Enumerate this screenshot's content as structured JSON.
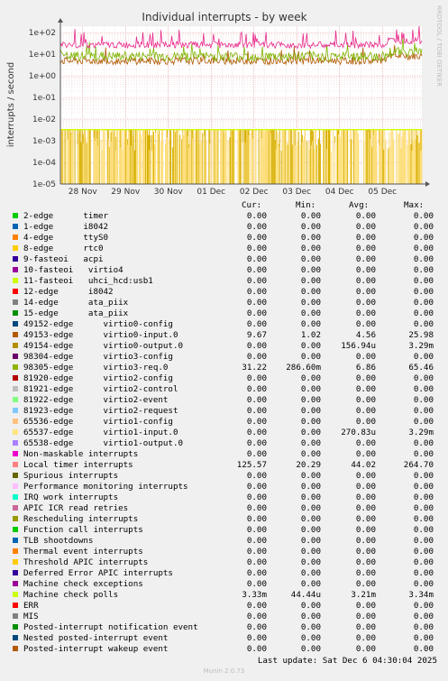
{
  "chart_data": {
    "type": "line",
    "title": "Individual interrupts - by week",
    "ylabel": "interrupts / second",
    "yscale": "log",
    "ylim": [
      1e-05,
      200
    ],
    "yticks": [
      "1e+02",
      "1e+01",
      "1e+00",
      "1e-01",
      "1e-02",
      "1e-03",
      "1e-04",
      "1e-05"
    ],
    "xlim": [
      "27 Nov",
      "6 Dec 04:30"
    ],
    "xticks": [
      "28 Nov",
      "29 Nov",
      "30 Nov",
      "01 Dec",
      "02 Dec",
      "03 Dec",
      "04 Dec",
      "05 Dec"
    ],
    "grid": true,
    "series": [
      {
        "name": "Local timer interrupts",
        "color": "#e7298a",
        "approx_level": 60
      },
      {
        "name": "98305-edge virtio3-req.0",
        "color": "#7db700",
        "approx_level": 8
      },
      {
        "name": "49153-edge virtio0-input.0",
        "color": "#b05a00",
        "approx_level": 5
      },
      {
        "name": "Machine check polls",
        "color": "#ccff00",
        "approx_level": 0.0033
      },
      {
        "name": "49154-edge virtio0-output.0",
        "color": "#d7b000",
        "approx_level": "0 to 3.29e-3 bursts"
      },
      {
        "name": "65537-edge virtio1-input.0",
        "color": "#ffe080",
        "approx_level": "0 to 3.29e-3 bursts"
      }
    ]
  },
  "legend_header": {
    "cur": "Cur:",
    "min": "Min:",
    "avg": "Avg:",
    "max": "Max:"
  },
  "legend": [
    {
      "name": "2-edge      timer",
      "color": "#00cc00",
      "cur": "0.00",
      "min": "0.00",
      "avg": "0.00",
      "max": "0.00"
    },
    {
      "name": "1-edge      i8042",
      "color": "#0066b3",
      "cur": "0.00",
      "min": "0.00",
      "avg": "0.00",
      "max": "0.00"
    },
    {
      "name": "4-edge      ttyS0",
      "color": "#ff8000",
      "cur": "0.00",
      "min": "0.00",
      "avg": "0.00",
      "max": "0.00"
    },
    {
      "name": "8-edge      rtc0",
      "color": "#ffcc00",
      "cur": "0.00",
      "min": "0.00",
      "avg": "0.00",
      "max": "0.00"
    },
    {
      "name": "9-fasteoi   acpi",
      "color": "#330099",
      "cur": "0.00",
      "min": "0.00",
      "avg": "0.00",
      "max": "0.00"
    },
    {
      "name": "10-fasteoi   virtio4",
      "color": "#990099",
      "cur": "0.00",
      "min": "0.00",
      "avg": "0.00",
      "max": "0.00"
    },
    {
      "name": "11-fasteoi   uhci_hcd:usb1",
      "color": "#ccff00",
      "cur": "0.00",
      "min": "0.00",
      "avg": "0.00",
      "max": "0.00"
    },
    {
      "name": "12-edge      i8042",
      "color": "#ff0000",
      "cur": "0.00",
      "min": "0.00",
      "avg": "0.00",
      "max": "0.00"
    },
    {
      "name": "14-edge      ata_piix",
      "color": "#808080",
      "cur": "0.00",
      "min": "0.00",
      "avg": "0.00",
      "max": "0.00"
    },
    {
      "name": "15-edge      ata_piix",
      "color": "#008f00",
      "cur": "0.00",
      "min": "0.00",
      "avg": "0.00",
      "max": "0.00"
    },
    {
      "name": "49152-edge      virtio0-config",
      "color": "#00487d",
      "cur": "0.00",
      "min": "0.00",
      "avg": "0.00",
      "max": "0.00"
    },
    {
      "name": "49153-edge      virtio0-input.0",
      "color": "#b35a00",
      "cur": "9.67",
      "min": "1.02",
      "avg": "4.56",
      "max": "25.98"
    },
    {
      "name": "49154-edge      virtio0-output.0",
      "color": "#b38f00",
      "cur": "0.00",
      "min": "0.00",
      "avg": "156.94u",
      "max": "3.29m"
    },
    {
      "name": "98304-edge      virtio3-config",
      "color": "#6b006b",
      "cur": "0.00",
      "min": "0.00",
      "avg": "0.00",
      "max": "0.00"
    },
    {
      "name": "98305-edge      virtio3-req.0",
      "color": "#8fb300",
      "cur": "31.22",
      "min": "286.60m",
      "avg": "6.86",
      "max": "65.46"
    },
    {
      "name": "81920-edge      virtio2-config",
      "color": "#b30000",
      "cur": "0.00",
      "min": "0.00",
      "avg": "0.00",
      "max": "0.00"
    },
    {
      "name": "81921-edge      virtio2-control",
      "color": "#bebebe",
      "cur": "0.00",
      "min": "0.00",
      "avg": "0.00",
      "max": "0.00"
    },
    {
      "name": "81922-edge      virtio2-event",
      "color": "#80ff80",
      "cur": "0.00",
      "min": "0.00",
      "avg": "0.00",
      "max": "0.00"
    },
    {
      "name": "81923-edge      virtio2-request",
      "color": "#80c9ff",
      "cur": "0.00",
      "min": "0.00",
      "avg": "0.00",
      "max": "0.00"
    },
    {
      "name": "65536-edge      virtio1-config",
      "color": "#ffc080",
      "cur": "0.00",
      "min": "0.00",
      "avg": "0.00",
      "max": "0.00"
    },
    {
      "name": "65537-edge      virtio1-input.0",
      "color": "#ffe680",
      "cur": "0.00",
      "min": "0.00",
      "avg": "270.83u",
      "max": "3.29m"
    },
    {
      "name": "65538-edge      virtio1-output.0",
      "color": "#aa80ff",
      "cur": "0.00",
      "min": "0.00",
      "avg": "0.00",
      "max": "0.00"
    },
    {
      "name": "Non-maskable interrupts",
      "color": "#ee00cc",
      "cur": "0.00",
      "min": "0.00",
      "avg": "0.00",
      "max": "0.00"
    },
    {
      "name": "Local timer interrupts",
      "color": "#ff8080",
      "cur": "125.57",
      "min": "20.29",
      "avg": "44.02",
      "max": "264.70"
    },
    {
      "name": "Spurious interrupts",
      "color": "#666600",
      "cur": "0.00",
      "min": "0.00",
      "avg": "0.00",
      "max": "0.00"
    },
    {
      "name": "Performance monitoring interrupts",
      "color": "#ffbfff",
      "cur": "0.00",
      "min": "0.00",
      "avg": "0.00",
      "max": "0.00"
    },
    {
      "name": "IRQ work interrupts",
      "color": "#00ffcc",
      "cur": "0.00",
      "min": "0.00",
      "avg": "0.00",
      "max": "0.00"
    },
    {
      "name": "APIC ICR read retries",
      "color": "#cc6699",
      "cur": "0.00",
      "min": "0.00",
      "avg": "0.00",
      "max": "0.00"
    },
    {
      "name": "Rescheduling interrupts",
      "color": "#999900",
      "cur": "0.00",
      "min": "0.00",
      "avg": "0.00",
      "max": "0.00"
    },
    {
      "name": "Function call interrupts",
      "color": "#00cc00",
      "cur": "0.00",
      "min": "0.00",
      "avg": "0.00",
      "max": "0.00"
    },
    {
      "name": "TLB shootdowns",
      "color": "#0066b3",
      "cur": "0.00",
      "min": "0.00",
      "avg": "0.00",
      "max": "0.00"
    },
    {
      "name": "Thermal event interrupts",
      "color": "#ff8000",
      "cur": "0.00",
      "min": "0.00",
      "avg": "0.00",
      "max": "0.00"
    },
    {
      "name": "Threshold APIC interrupts",
      "color": "#ffcc00",
      "cur": "0.00",
      "min": "0.00",
      "avg": "0.00",
      "max": "0.00"
    },
    {
      "name": "Deferred Error APIC interrupts",
      "color": "#330099",
      "cur": "0.00",
      "min": "0.00",
      "avg": "0.00",
      "max": "0.00"
    },
    {
      "name": "Machine check exceptions",
      "color": "#990099",
      "cur": "0.00",
      "min": "0.00",
      "avg": "0.00",
      "max": "0.00"
    },
    {
      "name": "Machine check polls",
      "color": "#ccff00",
      "cur": "3.33m",
      "min": "44.44u",
      "avg": "3.21m",
      "max": "3.34m"
    },
    {
      "name": "ERR",
      "color": "#ff0000",
      "cur": "0.00",
      "min": "0.00",
      "avg": "0.00",
      "max": "0.00"
    },
    {
      "name": "MIS",
      "color": "#808080",
      "cur": "0.00",
      "min": "0.00",
      "avg": "0.00",
      "max": "0.00"
    },
    {
      "name": "Posted-interrupt notification event",
      "color": "#008f00",
      "cur": "0.00",
      "min": "0.00",
      "avg": "0.00",
      "max": "0.00"
    },
    {
      "name": "Nested posted-interrupt event",
      "color": "#00487d",
      "cur": "0.00",
      "min": "0.00",
      "avg": "0.00",
      "max": "0.00"
    },
    {
      "name": "Posted-interrupt wakeup event",
      "color": "#b35a00",
      "cur": "0.00",
      "min": "0.00",
      "avg": "0.00",
      "max": "0.00"
    }
  ],
  "footer": {
    "last_update": "Last update: Sat Dec  6 04:30:04 2025",
    "munin": "Munin 2.0.73",
    "rrdtool": "RRDTOOL / TOBI OETIKER"
  }
}
